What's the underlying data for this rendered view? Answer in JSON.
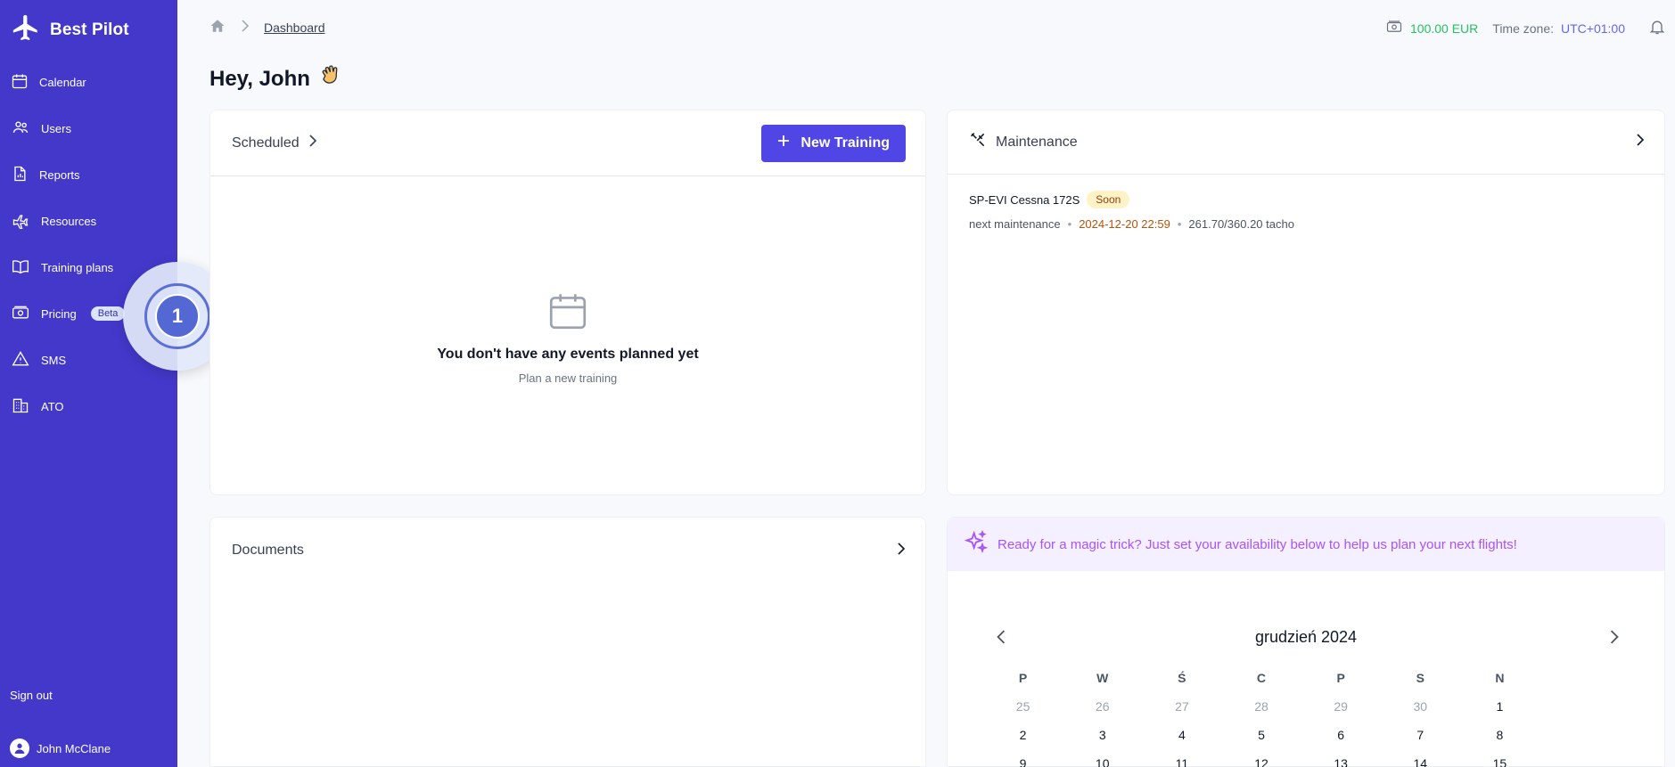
{
  "sidebar": {
    "brand": "Best Pilot",
    "items": [
      {
        "label": "Calendar",
        "icon": "calendar-icon"
      },
      {
        "label": "Users",
        "icon": "users-icon"
      },
      {
        "label": "Reports",
        "icon": "report-icon"
      },
      {
        "label": "Resources",
        "icon": "plane-icon"
      },
      {
        "label": "Training plans",
        "icon": "book-icon"
      },
      {
        "label": "Pricing",
        "icon": "money-icon",
        "badge": "Beta"
      },
      {
        "label": "SMS",
        "icon": "warning-icon"
      },
      {
        "label": "ATO",
        "icon": "building-icon"
      }
    ],
    "signout": "Sign out",
    "user_name": "John McClane",
    "color": "#4338ca"
  },
  "tour": {
    "step": "1"
  },
  "header": {
    "breadcrumb": "Dashboard",
    "balance": "100.00 EUR",
    "timezone_label": "Time zone:",
    "timezone_value": "UTC+01:00"
  },
  "greeting": "Hey, John",
  "scheduled": {
    "title": "Scheduled",
    "new_button": "New Training",
    "empty_title": "You don't have any events planned yet",
    "empty_sub": "Plan a new training"
  },
  "maintenance": {
    "title": "Maintenance",
    "aircraft": "SP-EVI Cessna 172S",
    "status": "Soon",
    "next_label": "next maintenance",
    "next_date": "2024-12-20 22:59",
    "tacho": "261.70/360.20 tacho"
  },
  "documents": {
    "title": "Documents"
  },
  "availability": {
    "banner": "Ready for a magic trick? Just set your availability below to help us plan your next flights!",
    "month": "grudzień 2024",
    "weekdays": [
      "P",
      "W",
      "Ś",
      "C",
      "P",
      "S",
      "N"
    ],
    "rows": [
      [
        "25",
        "26",
        "27",
        "28",
        "29",
        "30",
        "1"
      ],
      [
        "2",
        "3",
        "4",
        "5",
        "6",
        "7",
        "8"
      ],
      [
        "9",
        "10",
        "11",
        "12",
        "13",
        "14",
        "15"
      ]
    ]
  },
  "colors": {
    "accent": "#4f46e5",
    "balance": "#22c55e",
    "timezone": "#6366f1",
    "banner": "#a855f7"
  }
}
